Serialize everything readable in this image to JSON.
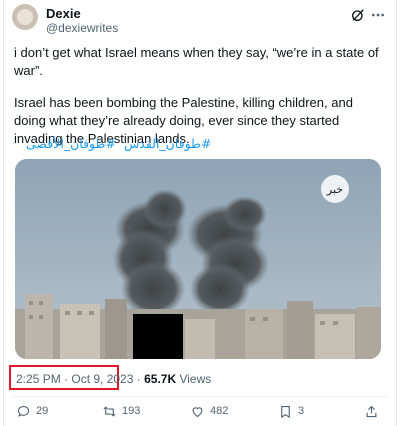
{
  "author": {
    "display_name": "Dexie",
    "handle": "@dexiewrites"
  },
  "tweet": {
    "paragraph_1": "i don’t get what Israel means when they say, “we’re in a state of war”.",
    "paragraph_2": "Israel has been bombing the Palestine, killing children, and doing what they’re already doing, ever since they started invading the Palestinian lands.",
    "hashtags": [
      "#طوفان_القدس",
      "#طوفان_الأقصى"
    ]
  },
  "media": {
    "watermark": "خبر"
  },
  "meta": {
    "timestamp": "2:25 PM · Oct 9, 2023",
    "separator": "·",
    "views_count": "65.7K",
    "views_label": "Views"
  },
  "actions": {
    "replies": "29",
    "retweets": "193",
    "likes": "482",
    "bookmarks": "3"
  },
  "icons": [
    "grok-icon",
    "more-icon",
    "reply-icon",
    "retweet-icon",
    "like-icon",
    "bookmark-icon",
    "share-icon"
  ],
  "colors": {
    "link": "#1d9bf0",
    "highlight_box": "#e0182c",
    "secondary_text": "#536471"
  }
}
